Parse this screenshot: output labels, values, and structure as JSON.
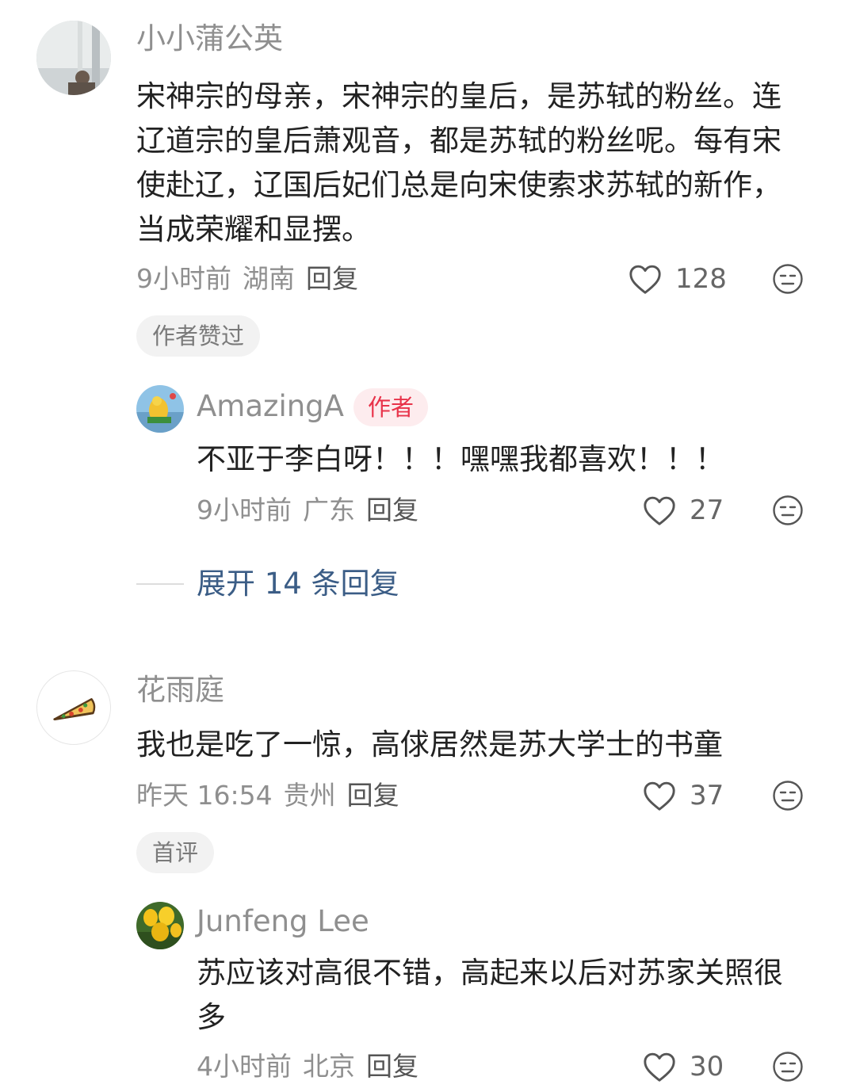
{
  "comments": [
    {
      "username": "小小蒲公英",
      "text": "宋神宗的母亲，宋神宗的皇后，是苏轼的粉丝。连辽道宗的皇后萧观音，都是苏轼的粉丝呢。每有宋使赴辽，辽国后妃们总是向宋使索求苏轼的新作，当成荣耀和显摆。",
      "time": "9小时前",
      "location": "湖南",
      "reply_label": "回复",
      "likes": "128",
      "tag": "作者赞过",
      "replies": [
        {
          "username": "AmazingA",
          "badge": "作者",
          "text": "不亚于李白呀！！！嘿嘿我都喜欢！！！",
          "time": "9小时前",
          "location": "广东",
          "reply_label": "回复",
          "likes": "27"
        }
      ],
      "expand_label": "展开 14 条回复"
    },
    {
      "username": "花雨庭",
      "text": "我也是吃了一惊，高俅居然是苏大学士的书童",
      "time": "昨天 16:54",
      "location": "贵州",
      "reply_label": "回复",
      "likes": "37",
      "tag": "首评",
      "replies": [
        {
          "username": "Junfeng Lee",
          "text": "苏应该对高很不错，高起来以后对苏家关照很多",
          "time": "4小时前",
          "location": "北京",
          "reply_label": "回复",
          "likes": "30"
        }
      ]
    }
  ],
  "icons": {
    "like": "heart-outline-icon",
    "dislike": "meh-face-icon"
  }
}
